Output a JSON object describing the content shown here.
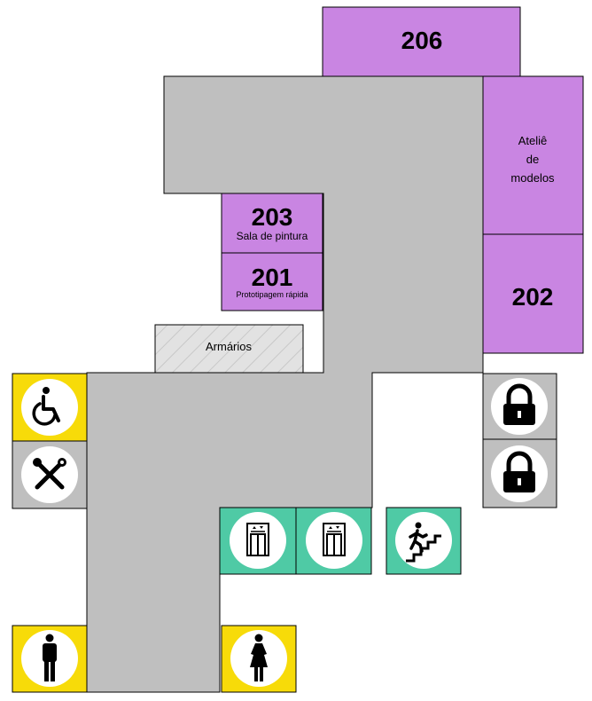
{
  "map": {
    "colors": {
      "corridor": "#bfbfbf",
      "room": "#c985e2",
      "storage": "#e2e2e2",
      "accessibility": "#f7db09",
      "service": "#bfbfbf",
      "vertical_transport": "#4fcaa5",
      "outline": "#000000"
    },
    "rooms": [
      {
        "id": "206",
        "number": "206",
        "label": ""
      },
      {
        "id": "atelie",
        "number": "",
        "label_lines": [
          "Ateliê",
          "de",
          "modelos"
        ]
      },
      {
        "id": "202",
        "number": "202",
        "label": ""
      },
      {
        "id": "203",
        "number": "203",
        "label": "Sala de pintura"
      },
      {
        "id": "201",
        "number": "201",
        "label": "Prototipagem rápida"
      }
    ],
    "storage": {
      "label": "Armários"
    },
    "icons": [
      {
        "id": "accessible",
        "icon": "wheelchair-icon",
        "category": "accessibility"
      },
      {
        "id": "tools",
        "icon": "wrench-screwdriver-icon",
        "category": "service"
      },
      {
        "id": "lock1",
        "icon": "lock-icon",
        "category": "service"
      },
      {
        "id": "lock2",
        "icon": "lock-icon",
        "category": "service"
      },
      {
        "id": "elevator1",
        "icon": "elevator-icon",
        "category": "vertical_transport"
      },
      {
        "id": "elevator2",
        "icon": "elevator-icon",
        "category": "vertical_transport"
      },
      {
        "id": "stairs",
        "icon": "stairs-icon",
        "category": "vertical_transport"
      },
      {
        "id": "men",
        "icon": "men-restroom-icon",
        "category": "accessibility"
      },
      {
        "id": "women",
        "icon": "women-restroom-icon",
        "category": "accessibility"
      }
    ]
  }
}
